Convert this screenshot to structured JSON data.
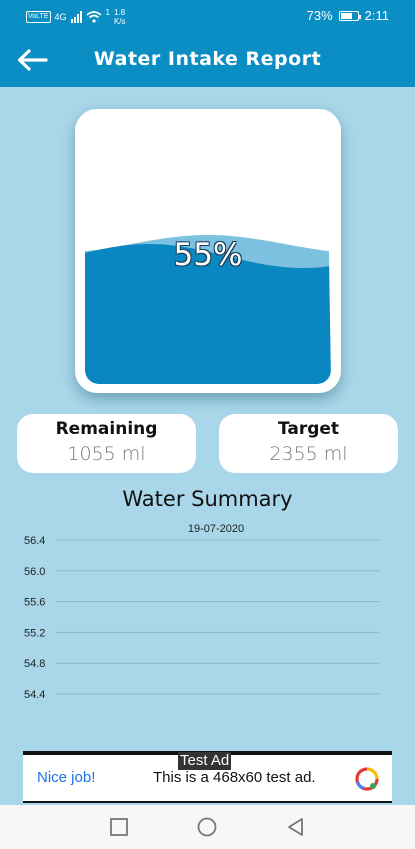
{
  "status_bar": {
    "volte": "VoLTE",
    "network": "4G",
    "network_sub": "1",
    "speed_value": "1.8",
    "speed_unit": "K/s",
    "battery": "73%",
    "battery_level": 0.73,
    "time": "2:11"
  },
  "app_bar": {
    "title": "Water Intake Report",
    "back_icon": "arrow-left-icon"
  },
  "water": {
    "percent_label": "55%",
    "fill_fraction": 0.55,
    "water_color": "#0a87c0",
    "wave_color": "#7cc2e0"
  },
  "stats": {
    "remaining_label": "Remaining",
    "remaining_value": "1055 ml",
    "target_label": "Target",
    "target_value": "2355 ml"
  },
  "summary": {
    "title": "Water Summary"
  },
  "chart_data": {
    "type": "line",
    "x": [
      "19-07-2020"
    ],
    "series": [],
    "yticks": [
      "56.4",
      "56.0",
      "55.6",
      "55.2",
      "54.8",
      "54.4"
    ],
    "grid": true
  },
  "ad": {
    "tag": "Test Ad",
    "headline": "Nice job!",
    "body": "This is a 468x60 test ad.",
    "logo_icon": "ad-logo-icon"
  },
  "nav": {
    "recent_icon": "square-recent-icon",
    "home_icon": "circle-home-icon",
    "back_icon": "triangle-back-icon"
  },
  "colors": {
    "primary": "#0b8ec4",
    "background": "#a9d7e9"
  }
}
